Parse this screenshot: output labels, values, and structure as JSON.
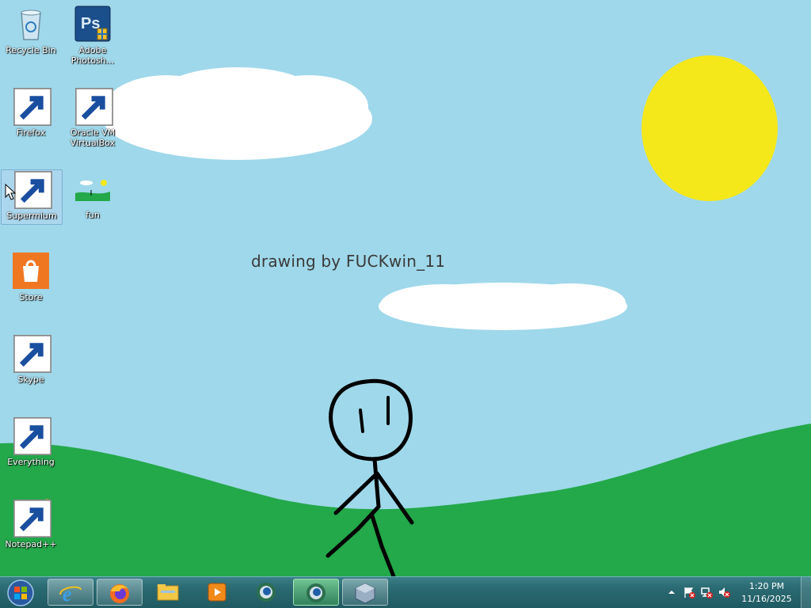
{
  "wallpaper": {
    "caption": "drawing by FUCKwin_11",
    "colors": {
      "sky": "#9fd8ea",
      "grass": "#23a84a",
      "sun": "#f5e81a",
      "cloud": "#ffffff",
      "stroke": "#000000"
    }
  },
  "desktop_icons": [
    {
      "label": "Recycle Bin",
      "icon": "recycle-bin-icon",
      "shortcut": false
    },
    {
      "label": "Adobe Photosh...",
      "icon": "photoshop-icon",
      "shortcut": false
    },
    {
      "label": "Firefox",
      "icon": "firefox-icon",
      "shortcut": true
    },
    {
      "label": "Oracle VM VirtualBox",
      "icon": "virtualbox-icon",
      "shortcut": true
    },
    {
      "label": "Supermium",
      "icon": "supermium-icon",
      "shortcut": true,
      "selected": true
    },
    {
      "label": "fun",
      "icon": "image-file-icon",
      "shortcut": false
    },
    {
      "label": "Store",
      "icon": "store-icon",
      "shortcut": false
    },
    {
      "label": "Skype",
      "icon": "skype-icon",
      "shortcut": true
    },
    {
      "label": "Everything",
      "icon": "everything-search-icon",
      "shortcut": true
    },
    {
      "label": "Notepad++",
      "icon": "notepad-plus-plus-icon",
      "shortcut": true
    }
  ],
  "taskbar": {
    "start_icon": "windows-start-orb-icon",
    "buttons": [
      {
        "icon": "internet-explorer-icon",
        "state": "pinned"
      },
      {
        "icon": "firefox-icon",
        "state": "pinned"
      },
      {
        "icon": "file-explorer-icon",
        "state": "pinned"
      },
      {
        "icon": "media-player-icon",
        "state": "pinned"
      },
      {
        "icon": "supermium-icon",
        "state": "pinned"
      },
      {
        "icon": "supermium-icon",
        "state": "running"
      },
      {
        "icon": "virtualbox-icon",
        "state": "pinned"
      }
    ],
    "tray_icons": [
      "show-hidden-icons-arrow-icon",
      "action-center-flag-icon",
      "network-icon",
      "volume-muted-icon"
    ],
    "clock": {
      "time": "1:20 PM",
      "date": "11/16/2025"
    }
  }
}
